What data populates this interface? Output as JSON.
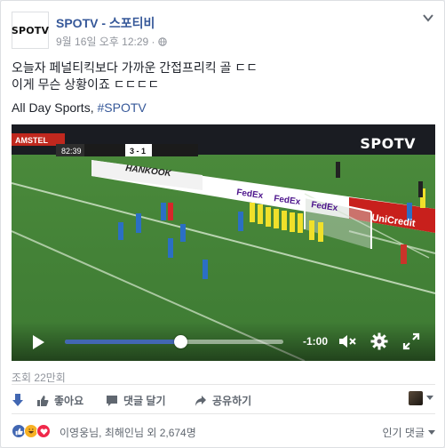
{
  "post": {
    "page_name": "SPOTV - 스포티비",
    "avatar_text": "SPOTV",
    "timestamp": "9월 16일 오후 12:29 ·",
    "text_line1": "오늘자 페널티킥보다 가까운 간접프리킥 골 ㄷㄷ",
    "text_line2": "이게 무슨 상황이죠 ㄷㄷㄷㄷ",
    "text_plain": "All Day Sports, ",
    "hashtag": "#SPOTV"
  },
  "video": {
    "watermark": "SPOTV",
    "scoreboard": {
      "time": "82:39",
      "score": "3 - 1"
    },
    "time_remaining": "-1:00",
    "progress": 0.53,
    "ad_boards": [
      "HANKOOK",
      "FedEx",
      "FedEx",
      "FedEx",
      "UniCredit",
      "AMSTEL"
    ]
  },
  "stats": {
    "views": "조회 22만회"
  },
  "actions": {
    "like": "좋아요",
    "comment": "댓글 달기",
    "share": "공유하기"
  },
  "reactions": {
    "reactors": "이영웅님, 최해인님 외 2,674명",
    "sort": "인기 댓글"
  },
  "colors": {
    "link": "#365899",
    "like_blue": "#4267b2",
    "muted": "#90949c"
  }
}
